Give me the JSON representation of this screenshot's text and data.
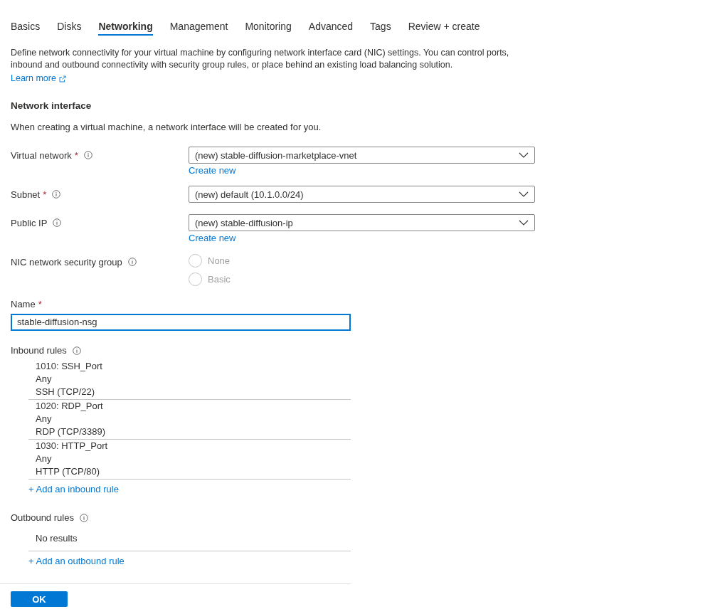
{
  "tabs": [
    {
      "label": "Basics",
      "selected": false
    },
    {
      "label": "Disks",
      "selected": false
    },
    {
      "label": "Networking",
      "selected": true
    },
    {
      "label": "Management",
      "selected": false
    },
    {
      "label": "Monitoring",
      "selected": false
    },
    {
      "label": "Advanced",
      "selected": false
    },
    {
      "label": "Tags",
      "selected": false
    },
    {
      "label": "Review + create",
      "selected": false
    }
  ],
  "intro": {
    "text": "Define network connectivity for your virtual machine by configuring network interface card (NIC) settings. You can control ports, inbound and outbound connectivity with security group rules, or place behind an existing load balancing solution.",
    "link": "Learn more"
  },
  "network_interface": {
    "heading": "Network interface",
    "description": "When creating a virtual machine, a network interface will be created for you.",
    "fields": [
      {
        "kind": "dropdown",
        "label": "Virtual network",
        "required_mark": "*",
        "value": "(new) stable-diffusion-marketplace-vnet",
        "link": "Create new"
      },
      {
        "kind": "dropdown",
        "label": "Subnet",
        "required_mark": "*",
        "value": "(new) default (10.1.0.0/24)"
      },
      {
        "kind": "dropdown",
        "label": "Public IP",
        "value": "(new) stable-diffusion-ip",
        "link": "Create new"
      },
      {
        "kind": "radio",
        "label": "NIC network security group",
        "options": [
          {
            "label": "None",
            "selected": false,
            "disabled": true
          },
          {
            "label": "Basic",
            "selected": false,
            "disabled": true
          }
        ]
      }
    ]
  },
  "name_field": {
    "label": "Name",
    "required_mark": "*",
    "value": "stable-diffusion-nsg"
  },
  "inbound_rules": {
    "label": "Inbound rules",
    "rows": [
      {
        "name": "1010: SSH_Port",
        "source": "Any",
        "service": "SSH (TCP/22)"
      },
      {
        "name": "1020: RDP_Port",
        "source": "Any",
        "service": "RDP (TCP/3389)"
      },
      {
        "name": "1030: HTTP_Port",
        "source": "Any",
        "service": "HTTP (TCP/80)"
      }
    ],
    "add_link": "+ Add an inbound rule"
  },
  "outbound_rules": {
    "label": "Outbound rules",
    "empty_text": "No results",
    "add_link": "+ Add an outbound rule"
  },
  "buttons": [
    "OK"
  ]
}
